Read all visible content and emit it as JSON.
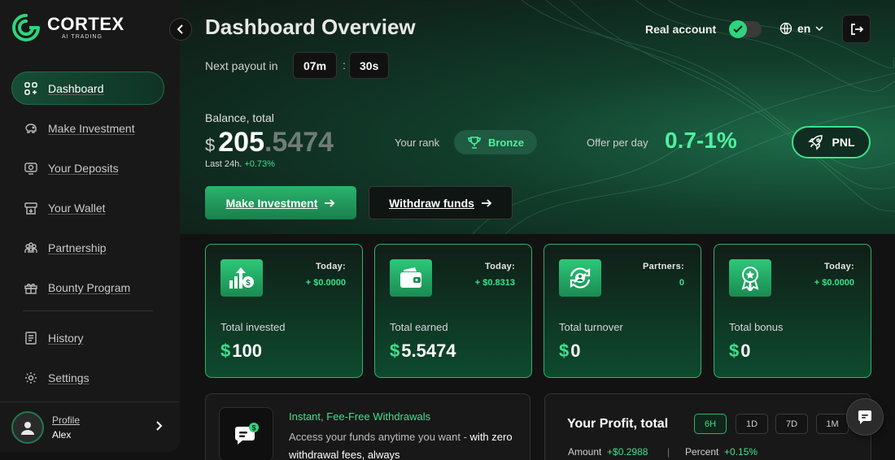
{
  "brand": {
    "name": "CORTEX",
    "subtitle": "AI TRADING"
  },
  "sidebar": {
    "items": [
      {
        "label": "Dashboard",
        "icon": "grid-icon",
        "active": true
      },
      {
        "label": "Make Investment",
        "icon": "piggy-bank-icon"
      },
      {
        "label": "Your Deposits",
        "icon": "deposit-icon"
      },
      {
        "label": "Your Wallet",
        "icon": "wallet-icon"
      },
      {
        "label": "Partnership",
        "icon": "partners-icon"
      },
      {
        "label": "Bounty Program",
        "icon": "gift-icon"
      },
      {
        "label": "History",
        "icon": "history-icon"
      },
      {
        "label": "Settings",
        "icon": "gear-icon"
      }
    ],
    "profile": {
      "link_label": "Profile",
      "name": "Alex"
    }
  },
  "header": {
    "title": "Dashboard Overview",
    "account_label": "Real account",
    "account_toggle_on": true,
    "language": "en"
  },
  "payout": {
    "label": "Next payout in",
    "minutes": "07m",
    "separator": ":",
    "seconds": "30s"
  },
  "balance": {
    "label": "Balance, total",
    "currency": "$",
    "integer": "205",
    "decimal": ".5474",
    "change_label": "Last 24h.",
    "change_value": "+0.73%"
  },
  "rank": {
    "label": "Your rank",
    "value": "Bronze"
  },
  "offer": {
    "label": "Offer per day",
    "value": "0.7-1%"
  },
  "pnl_button": "PNL",
  "actions": {
    "invest": "Make Investment",
    "withdraw": "Withdraw funds"
  },
  "stats": [
    {
      "meta_label": "Today:",
      "meta_value": "+ $0.0000",
      "title": "Total invested",
      "value": "100",
      "icon": "investment-growth-icon"
    },
    {
      "meta_label": "Today:",
      "meta_value": "+ $0.8313",
      "title": "Total earned",
      "value": "5.5474",
      "icon": "wallet-icon"
    },
    {
      "meta_label": "Partners:",
      "meta_value": "0",
      "title": "Total turnover",
      "value": "0",
      "icon": "user-cycle-icon"
    },
    {
      "meta_label": "Today:",
      "meta_value": "+ $0.0000",
      "title": "Total bonus",
      "value": "0",
      "icon": "award-icon"
    }
  ],
  "stat_currency": "$",
  "promo": {
    "title": "Instant, Fee-Free Withdrawals",
    "text": "Access your funds anytime you want - ",
    "text_bold": "with zero withdrawal fees, always"
  },
  "profit": {
    "title": "Your Profit, total",
    "periods": [
      "6H",
      "1D",
      "7D",
      "1M"
    ],
    "active_period": "6H",
    "amount_label": "Amount",
    "amount_value": "+$0.2988",
    "separator": "|",
    "percent_label": "Percent",
    "percent_value": "+0.15%"
  },
  "colors": {
    "accent": "#3ee08c",
    "accent_dark": "#1a7f4c",
    "background": "#121212",
    "panel": "#181818"
  }
}
